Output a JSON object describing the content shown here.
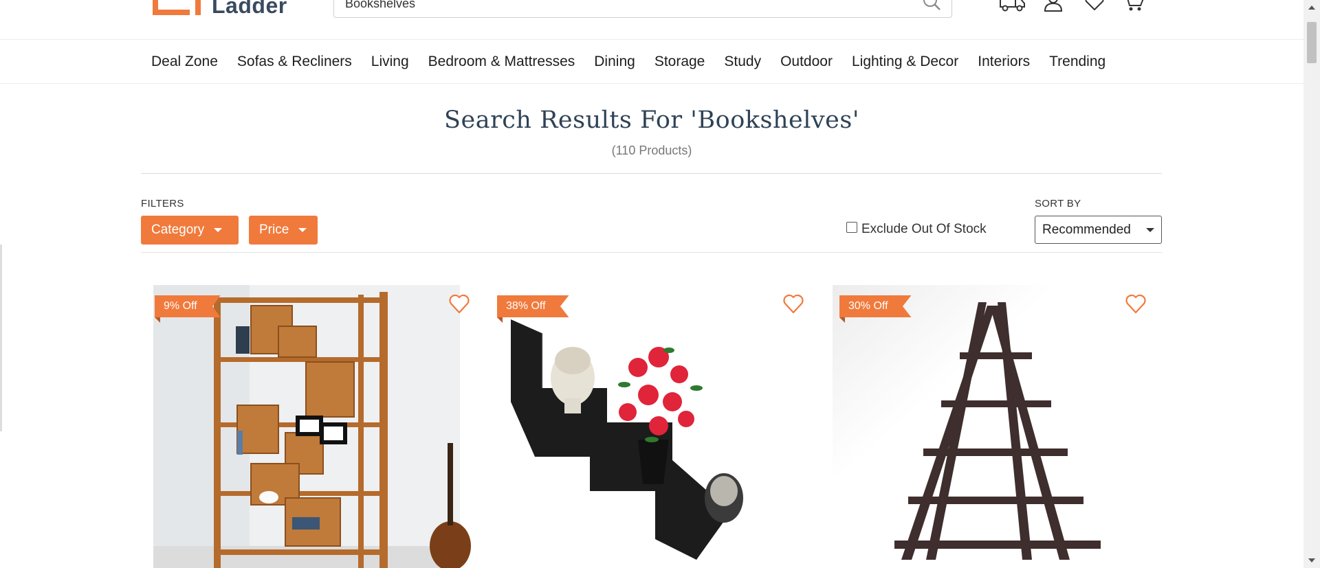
{
  "header": {
    "logo_text": "Ladder",
    "search": {
      "value": "Bookshelves",
      "placeholder": ""
    },
    "icons": [
      "delivery-truck-icon",
      "user-icon",
      "heart-icon",
      "cart-icon"
    ]
  },
  "nav": {
    "items": [
      "Deal Zone",
      "Sofas & Recliners",
      "Living",
      "Bedroom & Mattresses",
      "Dining",
      "Storage",
      "Study",
      "Outdoor",
      "Lighting & Decor",
      "Interiors",
      "Trending"
    ]
  },
  "results": {
    "title": "Search Results For 'Bookshelves'",
    "count": "(110 Products)"
  },
  "filters": {
    "label": "FILTERS",
    "category": "Category",
    "price": "Price",
    "exclude_out_of_stock": "Exclude Out Of Stock",
    "exclude_checked": false
  },
  "sort": {
    "label": "SORT BY",
    "selected": "Recommended"
  },
  "products": [
    {
      "badge": "9% Off",
      "image": "wooden-bookshelf-image"
    },
    {
      "badge": "38% Off",
      "image": "zigzag-wall-shelf-image"
    },
    {
      "badge": "30% Off",
      "image": "a-frame-ladder-shelf-image"
    }
  ],
  "colors": {
    "accent": "#f07a3c",
    "title": "#2f4256"
  }
}
